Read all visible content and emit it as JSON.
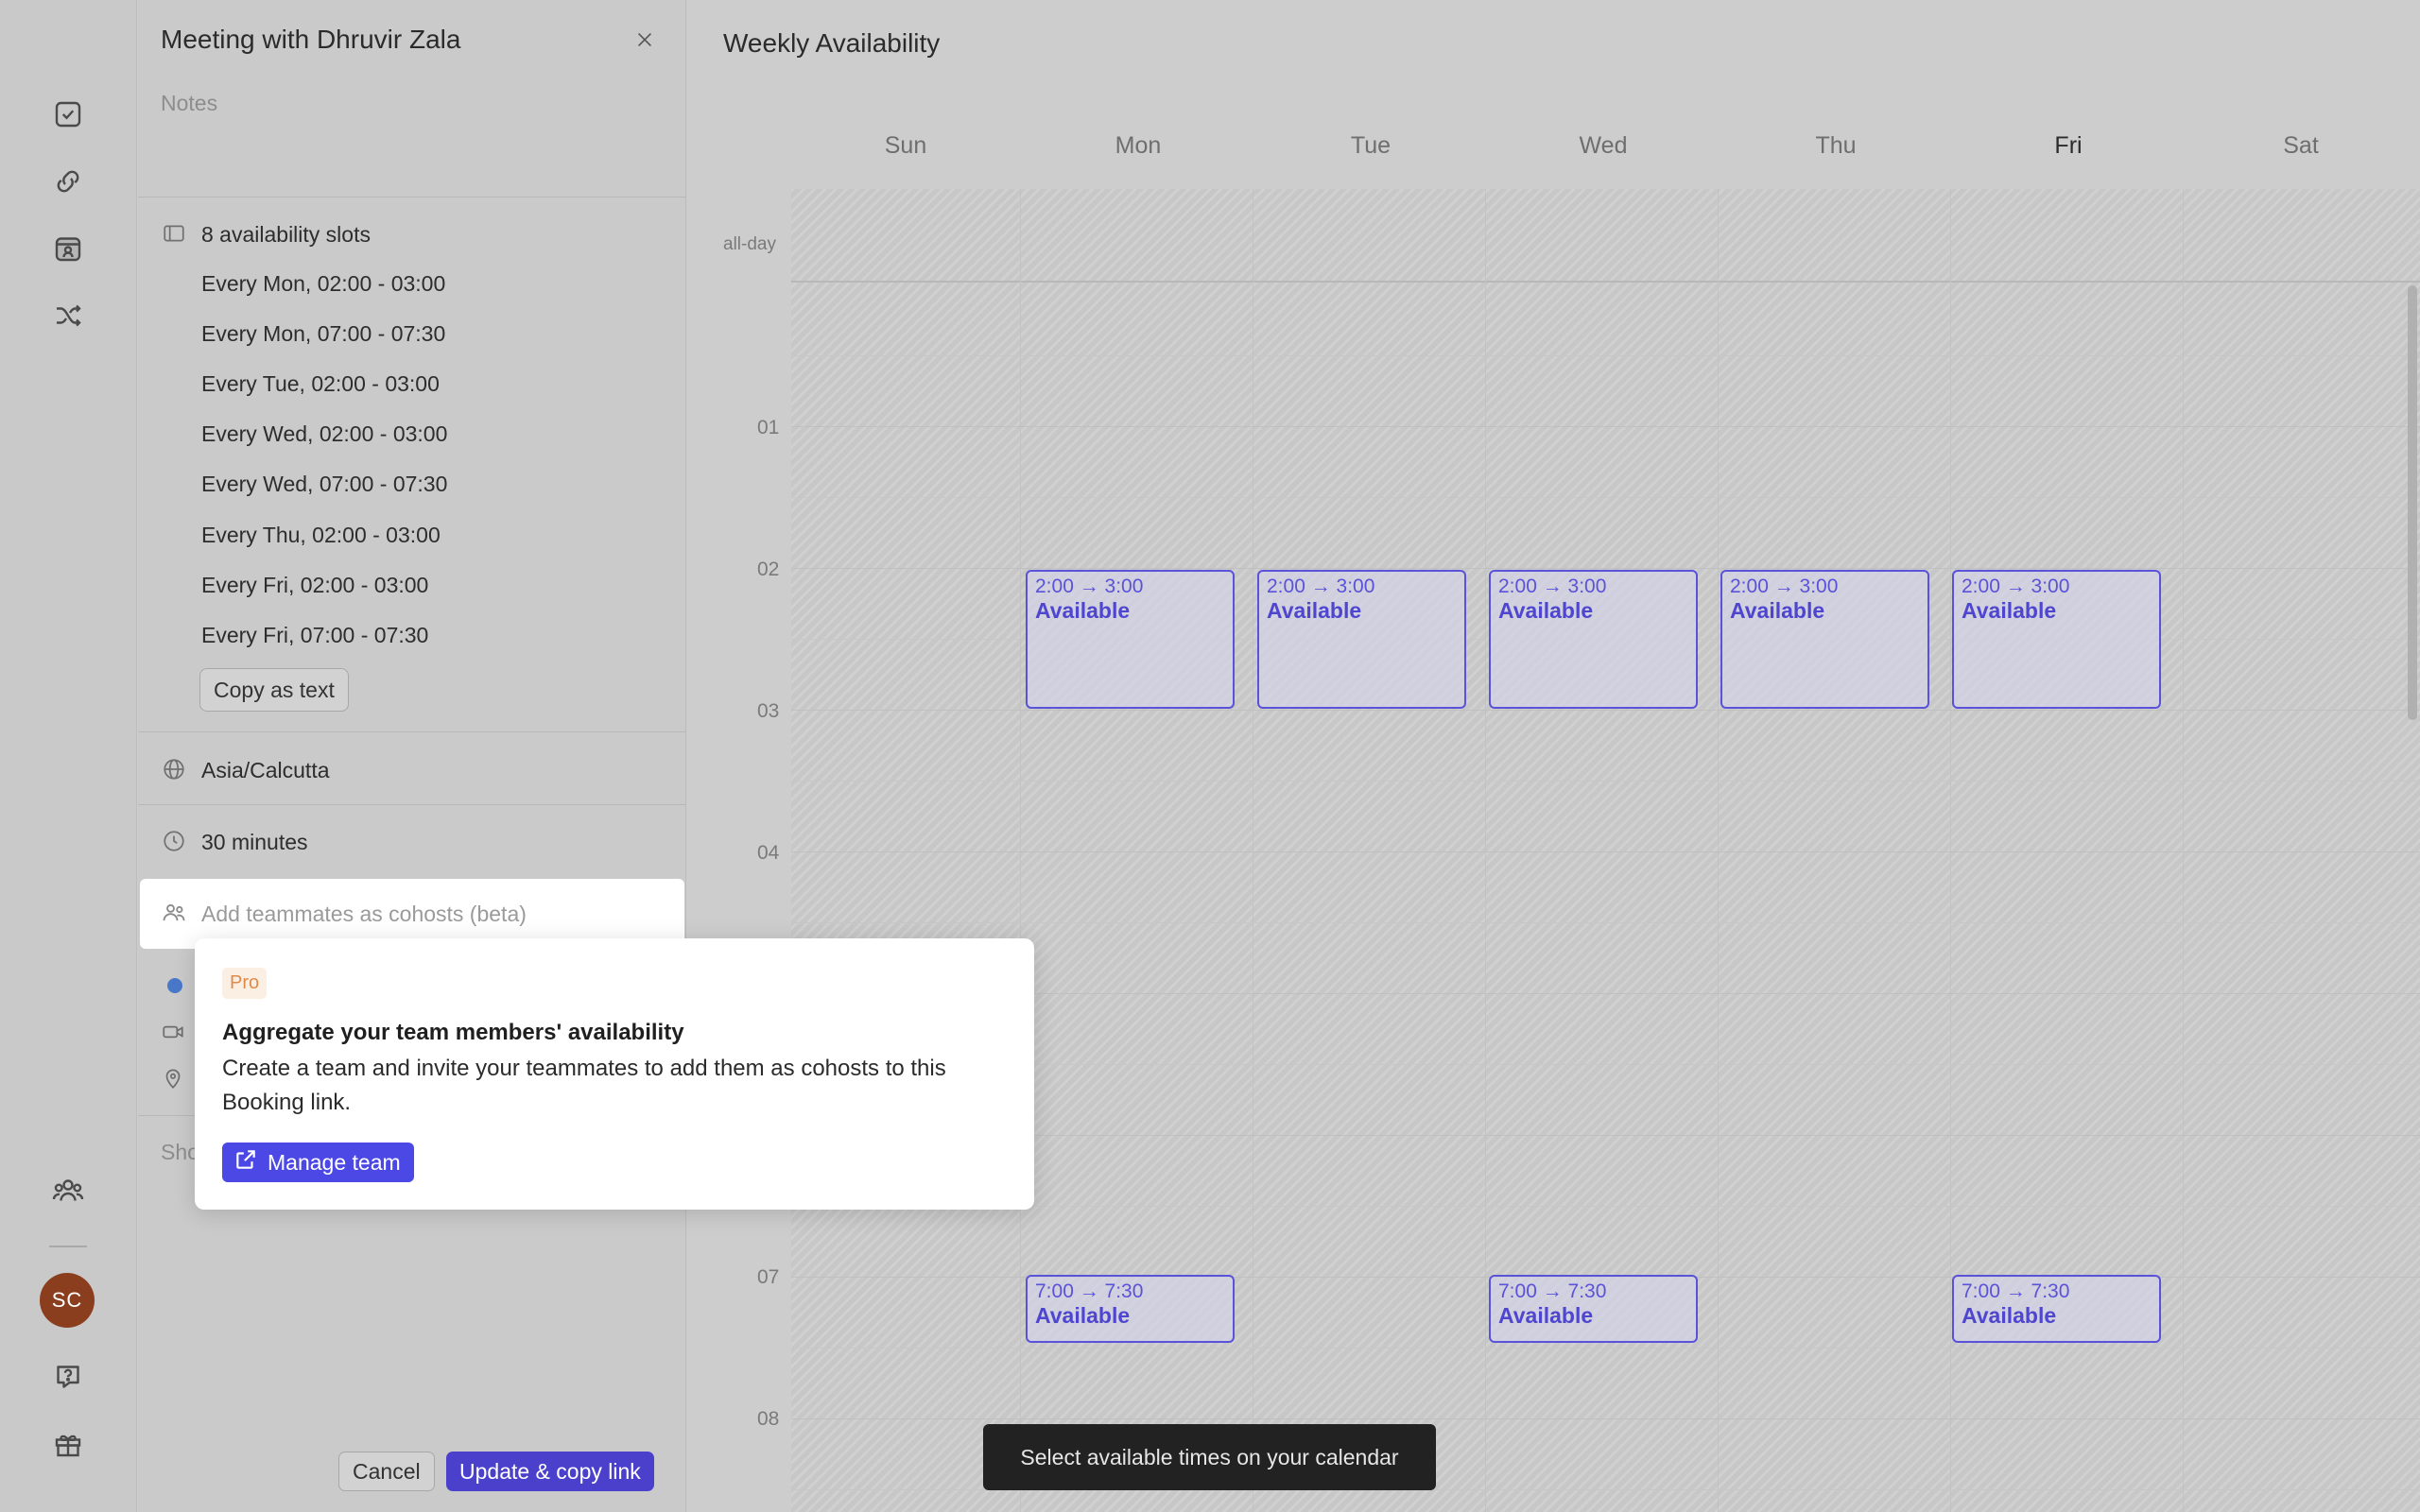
{
  "panel": {
    "title": "Meeting with Dhruvir Zala",
    "notes_placeholder": "Notes",
    "slots_header": "8 availability slots",
    "slots": [
      "Every Mon, 02:00 - 03:00",
      "Every Mon, 07:00 - 07:30",
      "Every Tue, 02:00 - 03:00",
      "Every Wed, 02:00 - 03:00",
      "Every Wed, 07:00 - 07:30",
      "Every Thu, 02:00 - 03:00",
      "Every Fri, 02:00 - 03:00",
      "Every Fri, 07:00 - 07:30"
    ],
    "copy_label": "Copy as text",
    "timezone": "Asia/Calcutta",
    "duration": "30 minutes",
    "cohost_placeholder": "Add teammates as cohosts (beta)",
    "show_text": "Sho",
    "cancel_label": "Cancel",
    "update_label": "Update & copy link"
  },
  "popover": {
    "badge": "Pro",
    "title": "Aggregate your team members' availability",
    "body": "Create a team and invite your teammates to add them as cohosts to this Booking link.",
    "button": "Manage team"
  },
  "calendar": {
    "title": "Weekly Availability",
    "days": [
      "Sun",
      "Mon",
      "Tue",
      "Wed",
      "Thu",
      "Fri",
      "Sat"
    ],
    "today": "Fri",
    "allday_label": "all-day",
    "hours": [
      "01",
      "02",
      "03",
      "04",
      "07",
      "08"
    ],
    "events": [
      {
        "day": "Mon",
        "time": "2:00 → 3:00",
        "label": "Available"
      },
      {
        "day": "Tue",
        "time": "2:00 → 3:00",
        "label": "Available"
      },
      {
        "day": "Wed",
        "time": "2:00 → 3:00",
        "label": "Available"
      },
      {
        "day": "Thu",
        "time": "2:00 → 3:00",
        "label": "Available"
      },
      {
        "day": "Fri",
        "time": "2:00 → 3:00",
        "label": "Available"
      },
      {
        "day": "Mon",
        "time": "7:00 → 7:30",
        "label": "Available"
      },
      {
        "day": "Wed",
        "time": "7:00 → 7:30",
        "label": "Available"
      },
      {
        "day": "Fri",
        "time": "7:00 → 7:30",
        "label": "Available"
      }
    ]
  },
  "toast": "Select available times on your calendar",
  "user": {
    "initials": "SC"
  },
  "colors": {
    "accent": "#4a40cc",
    "event_border": "#5a52d8",
    "pro_badge": "#e08a4a",
    "avatar": "#8a3e1e"
  },
  "icons": {
    "rail": [
      "checkbox-icon",
      "link-icon",
      "calendar-icon",
      "shuffle-icon",
      "team-icon",
      "help-icon",
      "gift-icon"
    ]
  }
}
